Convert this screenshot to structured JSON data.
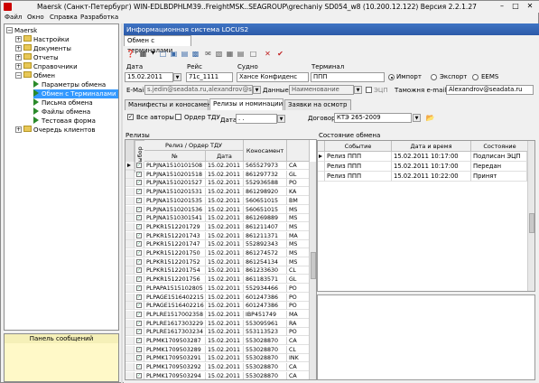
{
  "window": {
    "title": "Maersk (Санкт-Петербург) WIN-EDLBDPHLM39..FreightMSK..SEAGROUP\\grechaniy SD054_w8 (10.200.12.122) Версия 2.2.1.27"
  },
  "menu": [
    "Файл",
    "Окно",
    "Справка",
    "Разработка"
  ],
  "tree": {
    "root": "Maersk",
    "items": [
      {
        "label": "Настройки",
        "expander": "+"
      },
      {
        "label": "Документы",
        "expander": "+"
      },
      {
        "label": "Отчеты",
        "expander": "+"
      },
      {
        "label": "Справочники",
        "expander": "+"
      },
      {
        "label": "Обмен",
        "expander": "−"
      },
      {
        "label": "Параметры обмена"
      },
      {
        "label": "Обмен с Терминалами"
      },
      {
        "label": "Письма обмена"
      },
      {
        "label": "Файлы обмена"
      },
      {
        "label": "Тестовая форма"
      },
      {
        "label": "Очередь клиентов",
        "expander": "+"
      }
    ]
  },
  "message_panel": {
    "title": "Панель сообщений"
  },
  "panel": {
    "title": "Информационная система LOCUS2",
    "tab": "Обмен с терминалами"
  },
  "form": {
    "date_label": "Дата",
    "date_value": "15.02.2011",
    "voyage_label": "Рейс",
    "voyage_value": "71с_1111",
    "vessel_label": "Судно",
    "vessel_value": "Хансе Конфиденс",
    "terminal_label": "Терминал",
    "terminal_value": "ППП",
    "radio_import": "Импорт",
    "radio_export": "Экспорт",
    "radio_eems": "EEMS",
    "email_label": "E-Mail",
    "email_value": "s.jedin@seadata.ru,alexandrov@se",
    "data_label": "Данные",
    "data_value": "Наименование",
    "ecp_label": "ЭЦП",
    "customs_label": "Таможня e-mail",
    "customs_value": "Alexandrov@seadata.ru"
  },
  "subtabs": [
    "Манифесты и коносаменты",
    "Релизы и номинации",
    "Заявки на осмотр"
  ],
  "filter": {
    "all_authors_label": "Все авторы",
    "order_tdu_label": "Ордер ТДУ",
    "date_label": "Дата",
    "date_value": ". .",
    "contract_label": "Договор",
    "contract_value": "КТЭ 265-2009"
  },
  "releases": {
    "section_title": "Релизы",
    "headers": {
      "select": "Выбор",
      "group": "Релиз / Ордер ТДУ",
      "num": "№",
      "date": "Дата",
      "bl": "Коносамент",
      "extra": ""
    },
    "rows": [
      [
        "PLPJNA1510101508",
        "15.02.2011",
        "565527973",
        "CA"
      ],
      [
        "PLPJNA1510201518",
        "15.02.2011",
        "861297732",
        "GL"
      ],
      [
        "PLPJNA1510201527",
        "15.02.2011",
        "552936588",
        "PO"
      ],
      [
        "PLPJNA1510201531",
        "15.02.2011",
        "861298920",
        "KA"
      ],
      [
        "PLPJNA1510201535",
        "15.02.2011",
        "560651015",
        "BM"
      ],
      [
        "PLPJNA1510201536",
        "15.02.2011",
        "560651015",
        "MS"
      ],
      [
        "PLPJNA1510301541",
        "15.02.2011",
        "861269889",
        "MS"
      ],
      [
        "PLPKR1512201729",
        "15.02.2011",
        "861211407",
        "MS"
      ],
      [
        "PLPKR1512201743",
        "15.02.2011",
        "861211371",
        "MA"
      ],
      [
        "PLPKR1512201747",
        "15.02.2011",
        "552892343",
        "MS"
      ],
      [
        "PLPKR1512201750",
        "15.02.2011",
        "861274572",
        "MS"
      ],
      [
        "PLPKR1512201752",
        "15.02.2011",
        "861254134",
        "MS"
      ],
      [
        "PLPKR1512201754",
        "15.02.2011",
        "861233630",
        "CL"
      ],
      [
        "PLPKR1512201756",
        "15.02.2011",
        "861183571",
        "GL"
      ],
      [
        "PLPAPA1515102805",
        "15.02.2011",
        "552934466",
        "PO"
      ],
      [
        "PLPAGE1516402215",
        "15.02.2011",
        "601247386",
        "PO"
      ],
      [
        "PLPAGE1516402216",
        "15.02.2011",
        "601247386",
        "PO"
      ],
      [
        "PLPLRE1517002358",
        "15.02.2011",
        "IBP451749",
        "MA"
      ],
      [
        "PLPLRE1617303229",
        "15.02.2011",
        "553095961",
        "RA"
      ],
      [
        "PLPLRE1617303234",
        "15.02.2011",
        "553113523",
        "PO"
      ],
      [
        "PLPMK1709503287",
        "15.02.2011",
        "553028870",
        "CA"
      ],
      [
        "PLPMK1709503289",
        "15.02.2011",
        "553028870",
        "CL"
      ],
      [
        "PLPMK1709503291",
        "15.02.2011",
        "553028870",
        "INK"
      ],
      [
        "PLPMK1709503292",
        "15.02.2011",
        "553028870",
        "CA"
      ],
      [
        "PLPMK1709503294",
        "15.02.2011",
        "553028870",
        "CA"
      ]
    ]
  },
  "exchange": {
    "section_title": "Состояние обмена",
    "headers": [
      "Событие",
      "Дата и время",
      "Состояние"
    ],
    "rows": [
      [
        "Релиз ППП",
        "15.02.2011 10:17:00",
        "Подписан ЭЦП"
      ],
      [
        "Релиз ППП",
        "15.02.2011 10:17:00",
        "Передан"
      ],
      [
        "Релиз ППП",
        "15.02.2011 10:22:00",
        "Принят"
      ]
    ]
  },
  "colors": {
    "title_bar": "#2c5aa8",
    "selection": "#3399ff",
    "message_panel": "#fff9c8"
  }
}
